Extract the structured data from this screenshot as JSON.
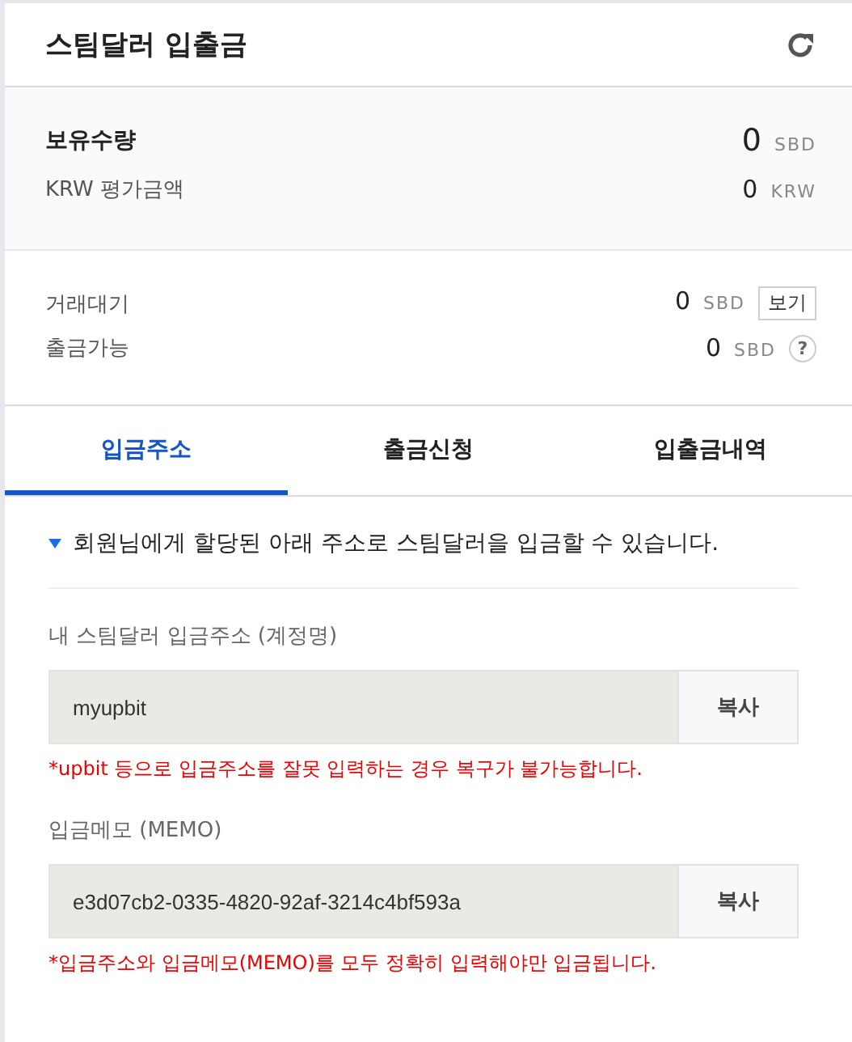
{
  "title": "스팀달러 입출금",
  "holdings": [
    {
      "label": "보유수량",
      "value": "0",
      "unit": "SBD",
      "kind": "main"
    },
    {
      "label": "KRW 평가금액",
      "value": "0",
      "unit": "KRW",
      "kind": "sub"
    }
  ],
  "balances": [
    {
      "label": "거래대기",
      "value": "0",
      "unit": "SBD",
      "action": "보기"
    },
    {
      "label": "출금가능",
      "value": "0",
      "unit": "SBD",
      "help": "?"
    }
  ],
  "tabs": [
    {
      "label": "입금주소",
      "selected": true
    },
    {
      "label": "출금신청",
      "selected": false
    },
    {
      "label": "입출금내역",
      "selected": false
    }
  ],
  "notice": "회원님에게 할당된 아래 주소로 스팀달러을 입금할 수 있습니다.",
  "fields": [
    {
      "label": "내 스팀달러 입금주소 (계정명)",
      "value": "myupbit",
      "button": "복사",
      "warning": "*upbit 등으로 입금주소를 잘못 입력하는 경우 복구가 불가능합니다."
    },
    {
      "label": "입금메모 (MEMO)",
      "value": "e3d07cb2-0335-4820-92af-3214c4bf593a",
      "button": "복사",
      "warning": "*입금주소와 입금메모(MEMO)를 모두 정확히 입력해야만 입금됩니다."
    }
  ]
}
